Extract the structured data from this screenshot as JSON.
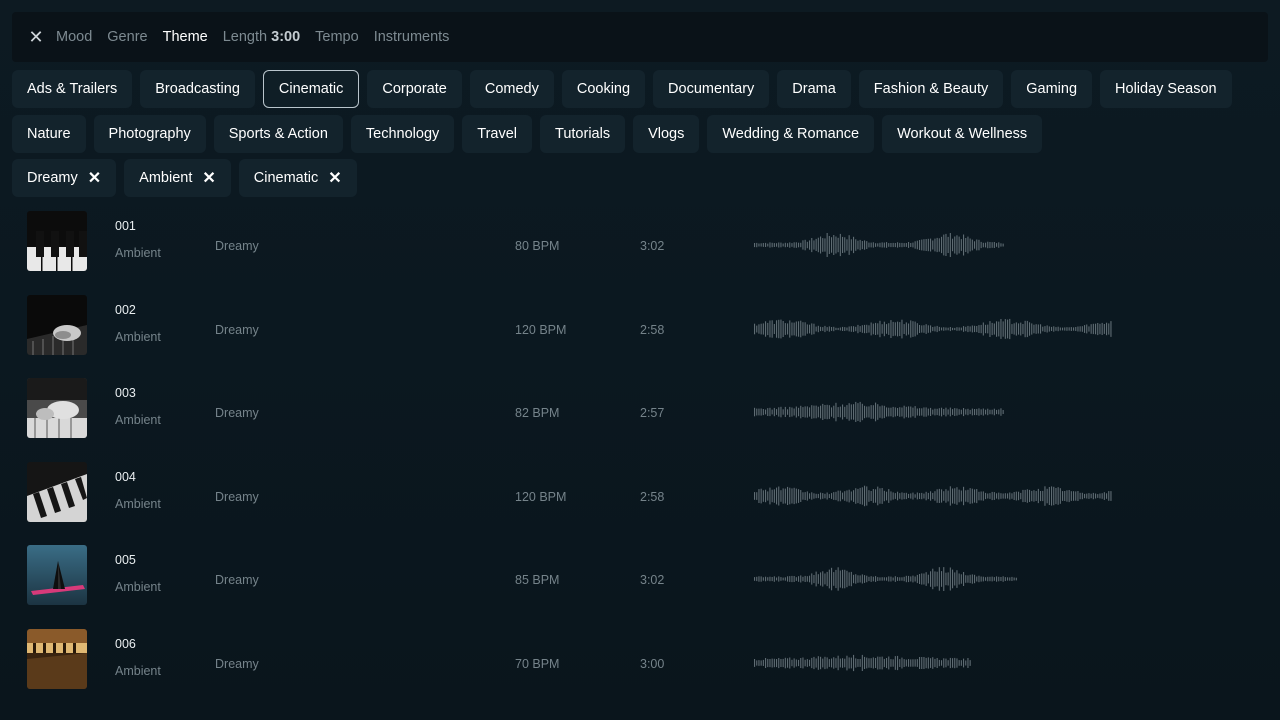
{
  "filter_bar": {
    "tabs": [
      {
        "label": "Mood"
      },
      {
        "label": "Genre"
      },
      {
        "label": "Theme",
        "active": true
      },
      {
        "label": "Length",
        "value": "3:00"
      },
      {
        "label": "Tempo"
      },
      {
        "label": "Instruments"
      }
    ]
  },
  "themes_row1": [
    "Ads & Trailers",
    "Broadcasting",
    "Cinematic",
    "Corporate",
    "Comedy",
    "Cooking",
    "Documentary",
    "Drama",
    "Fashion & Beauty",
    "Gaming",
    "Holiday Season"
  ],
  "themes_row2": [
    "Nature",
    "Photography",
    "Sports & Action",
    "Technology",
    "Travel",
    "Tutorials",
    "Vlogs",
    "Wedding & Romance",
    "Workout & Wellness"
  ],
  "selected_theme": "Cinematic",
  "active_filters": [
    "Dreamy",
    "Ambient",
    "Cinematic"
  ],
  "tracks": [
    {
      "number": "001",
      "genre": "Ambient",
      "mood": "Dreamy",
      "bpm": "80 BPM",
      "length": "3:02",
      "thumb": "piano-keys-white"
    },
    {
      "number": "002",
      "genre": "Ambient",
      "mood": "Dreamy",
      "bpm": "120 BPM",
      "length": "2:58",
      "thumb": "hands-on-piano-dark"
    },
    {
      "number": "003",
      "genre": "Ambient",
      "mood": "Dreamy",
      "bpm": "82 BPM",
      "length": "2:57",
      "thumb": "hands-on-piano-bw"
    },
    {
      "number": "004",
      "genre": "Ambient",
      "mood": "Dreamy",
      "bpm": "120 BPM",
      "length": "2:58",
      "thumb": "piano-keys-angle"
    },
    {
      "number": "005",
      "genre": "Ambient",
      "mood": "Dreamy",
      "bpm": "85 BPM",
      "length": "3:02",
      "thumb": "sail-neon"
    },
    {
      "number": "006",
      "genre": "Ambient",
      "mood": "Dreamy",
      "bpm": "70 BPM",
      "length": "3:00",
      "thumb": "vintage-piano-warm"
    }
  ],
  "colors": {
    "accent": "#b9c5cc",
    "chip_bg": "#13232c",
    "muted_text": "#75838a",
    "waveform": "#5f6c73"
  }
}
